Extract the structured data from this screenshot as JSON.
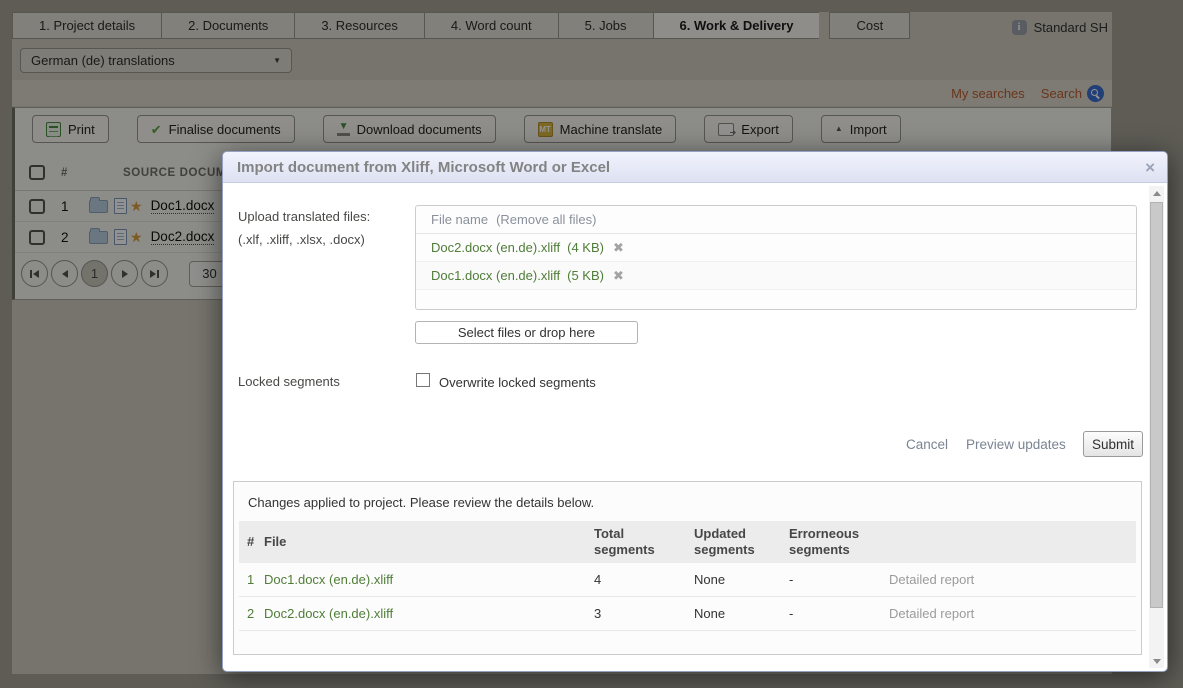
{
  "header": {
    "tabs": [
      {
        "label": "1. Project details",
        "active": false
      },
      {
        "label": "2. Documents",
        "active": false
      },
      {
        "label": "3. Resources",
        "active": false
      },
      {
        "label": "4. Word count",
        "active": false
      },
      {
        "label": "5. Jobs",
        "active": false
      },
      {
        "label": "6. Work & Delivery",
        "active": true
      },
      {
        "label": "Cost",
        "active": false
      }
    ],
    "user_label": "Standard SH",
    "info_icon_glyph": "i"
  },
  "filters": {
    "language_selector": "German (de) translations",
    "my_searches": "My searches",
    "search": "Search"
  },
  "toolbar": {
    "print": "Print",
    "finalise": "Finalise documents",
    "download": "Download documents",
    "machine_translate": "Machine translate",
    "export": "Export",
    "import": "Import",
    "mt_icon_text": "MT"
  },
  "documents_table": {
    "col_number": "#",
    "col_source": "SOURCE DOCUME",
    "rows": [
      {
        "num": "1",
        "name": "Doc1.docx",
        "star": "★"
      },
      {
        "num": "2",
        "name": "Doc2.docx",
        "star": "★"
      }
    ],
    "current_page": "1",
    "page_size": "30"
  },
  "modal": {
    "title": "Import document from Xliff, Microsoft Word or Excel",
    "close_glyph": "×",
    "upload_label": "Upload translated files:",
    "upload_formats": "(.xlf, .xliff, .xlsx, .docx)",
    "file_list": {
      "header": "File name",
      "remove_all": "(Remove all files)",
      "files": [
        {
          "name": "Doc2.docx (en.de).xliff",
          "size": "(4 KB)",
          "remove_glyph": "✖"
        },
        {
          "name": "Doc1.docx (en.de).xliff",
          "size": "(5 KB)",
          "remove_glyph": "✖"
        }
      ]
    },
    "select_files_button": "Select files or drop here",
    "locked_segments_label": "Locked segments",
    "overwrite_checkbox_label": "Overwrite locked segments",
    "cancel": "Cancel",
    "preview_updates": "Preview updates",
    "submit": "Submit",
    "results": {
      "message": "Changes applied to project. Please review the details below.",
      "columns": {
        "num": "#",
        "file": "File",
        "total": "Total segments",
        "updated": "Updated segments",
        "erroneous": "Errorneous segments"
      },
      "rows": [
        {
          "num": "1",
          "file": "Doc1.docx (en.de).xliff",
          "total": "4",
          "updated": "None",
          "erroneous": "-",
          "report": "Detailed report"
        },
        {
          "num": "2",
          "file": "Doc2.docx (en.de).xliff",
          "total": "3",
          "updated": "None",
          "erroneous": "-",
          "report": "Detailed report"
        }
      ]
    }
  },
  "colors": {
    "file_link_green": "#4f7d37",
    "search_link_orange": "#b85c30",
    "modal_header_blue": "#e8ebf7",
    "search_icon_blue": "#3b6bcc"
  }
}
